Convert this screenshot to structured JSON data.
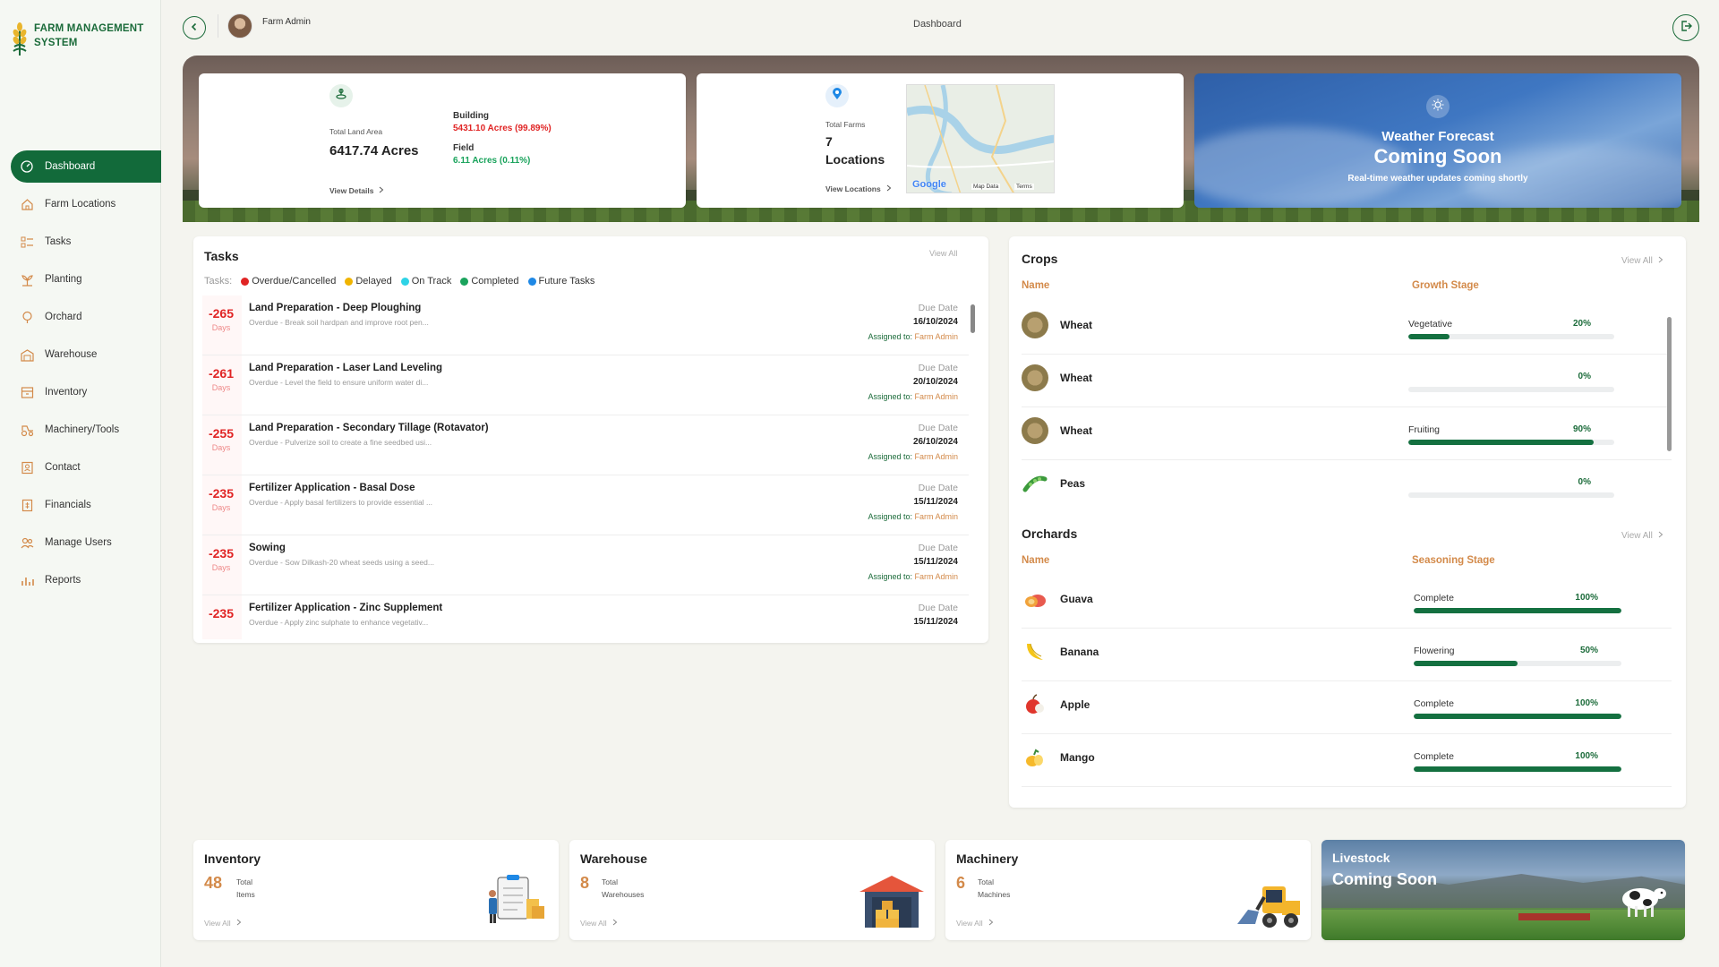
{
  "app": {
    "title": "FARM MANAGEMENT SYSTEM",
    "title_line1": "FARM MANAGEMENT",
    "title_line2": "SYSTEM"
  },
  "sidebar": {
    "items": [
      {
        "label": "Dashboard",
        "icon": "dashboard-icon",
        "active": true
      },
      {
        "label": "Farm Locations",
        "icon": "farm-locations-icon"
      },
      {
        "label": "Tasks",
        "icon": "tasks-icon"
      },
      {
        "label": "Planting",
        "icon": "planting-icon"
      },
      {
        "label": "Orchard",
        "icon": "orchard-icon"
      },
      {
        "label": "Warehouse",
        "icon": "warehouse-icon"
      },
      {
        "label": "Inventory",
        "icon": "inventory-icon"
      },
      {
        "label": "Machinery/Tools",
        "icon": "machinery-icon"
      },
      {
        "label": "Contact",
        "icon": "contact-icon"
      },
      {
        "label": "Financials",
        "icon": "financials-icon"
      },
      {
        "label": "Manage Users",
        "icon": "users-icon"
      },
      {
        "label": "Reports",
        "icon": "reports-icon"
      }
    ]
  },
  "header": {
    "user": "Farm Admin",
    "page_title": "Dashboard"
  },
  "land": {
    "label": "Total Land Area",
    "value": "6417.74 Acres",
    "building_label": "Building",
    "building_value": "5431.10 Acres (99.89%)",
    "field_label": "Field",
    "field_value": "6.11 Acres (0.11%)",
    "view": "View Details"
  },
  "farms": {
    "label": "Total Farms",
    "count": "7",
    "unit": "Locations",
    "view": "View Locations",
    "map_labels": {
      "google": "Google",
      "map_data": "Map Data",
      "terms": "Terms"
    }
  },
  "weather": {
    "title": "Weather Forecast",
    "status": "Coming Soon",
    "subtitle": "Real-time weather updates coming shortly"
  },
  "tasks": {
    "title": "Tasks",
    "view_all": "View All",
    "legend_label": "Tasks:",
    "legend": [
      {
        "label": "Overdue/Cancelled",
        "color": "#e02424"
      },
      {
        "label": "Delayed",
        "color": "#f0b400"
      },
      {
        "label": "On Track",
        "color": "#2ed3e6"
      },
      {
        "label": "Completed",
        "color": "#1aa35c"
      },
      {
        "label": "Future Tasks",
        "color": "#1e88e5"
      }
    ],
    "due_label": "Due Date",
    "assigned_label": "Assigned to:",
    "days_label": "Days",
    "rows": [
      {
        "days": "-265",
        "title": "Land Preparation - Deep Ploughing",
        "desc": "Overdue - Break soil hardpan and improve root pen...",
        "date": "16/10/2024",
        "assignee": "Farm Admin"
      },
      {
        "days": "-261",
        "title": "Land Preparation - Laser Land Leveling",
        "desc": "Overdue - Level the field to ensure uniform water di...",
        "date": "20/10/2024",
        "assignee": "Farm Admin"
      },
      {
        "days": "-255",
        "title": "Land Preparation - Secondary Tillage (Rotavator)",
        "desc": "Overdue - Pulverize soil to create a fine seedbed usi...",
        "date": "26/10/2024",
        "assignee": "Farm Admin"
      },
      {
        "days": "-235",
        "title": "Fertilizer Application - Basal Dose",
        "desc": "Overdue - Apply basal fertilizers to provide essential ...",
        "date": "15/11/2024",
        "assignee": "Farm Admin"
      },
      {
        "days": "-235",
        "title": "Sowing",
        "desc": "Overdue - Sow Dilkash-20 wheat seeds using a seed...",
        "date": "15/11/2024",
        "assignee": "Farm Admin"
      },
      {
        "days": "-235",
        "title": "Fertilizer Application - Zinc Supplement",
        "desc": "Overdue - Apply zinc sulphate to enhance vegetativ...",
        "date": "15/11/2024",
        "assignee": ""
      }
    ]
  },
  "crops": {
    "title": "Crops",
    "view_all": "View All",
    "col_name": "Name",
    "col_stage": "Growth Stage",
    "rows": [
      {
        "name": "Wheat",
        "stage": "Vegetative",
        "pct": "20%",
        "progress": 0.2,
        "icon": "wheat-icon"
      },
      {
        "name": "Wheat",
        "stage": "",
        "pct": "0%",
        "progress": 0,
        "icon": "wheat-icon"
      },
      {
        "name": "Wheat",
        "stage": "Fruiting",
        "pct": "90%",
        "progress": 0.9,
        "icon": "wheat-icon"
      },
      {
        "name": "Peas",
        "stage": "",
        "pct": "0%",
        "progress": 0,
        "icon": "peas-icon"
      }
    ]
  },
  "orchards": {
    "title": "Orchards",
    "view_all": "View All",
    "col_name": "Name",
    "col_stage": "Seasoning Stage",
    "rows": [
      {
        "name": "Guava",
        "stage": "Complete",
        "pct": "100%",
        "progress": 1,
        "icon": "guava-icon"
      },
      {
        "name": "Banana",
        "stage": "Flowering",
        "pct": "50%",
        "progress": 0.5,
        "icon": "banana-icon"
      },
      {
        "name": "Apple",
        "stage": "Complete",
        "pct": "100%",
        "progress": 1,
        "icon": "apple-icon"
      },
      {
        "name": "Mango",
        "stage": "Complete",
        "pct": "100%",
        "progress": 1,
        "icon": "mango-icon"
      }
    ]
  },
  "bottom": {
    "inventory": {
      "title": "Inventory",
      "count": "48",
      "sub1": "Total",
      "sub2": "Items",
      "view": "View All"
    },
    "warehouse": {
      "title": "Warehouse",
      "count": "8",
      "sub1": "Total",
      "sub2": "Warehouses",
      "view": "View All"
    },
    "machinery": {
      "title": "Machinery",
      "count": "6",
      "sub1": "Total",
      "sub2": "Machines",
      "view": "View All"
    },
    "livestock": {
      "title": "Livestock",
      "status": "Coming Soon"
    }
  },
  "colors": {
    "brand_green": "#126a3a",
    "accent_orange": "#d38a4a",
    "overdue_red": "#e02424"
  }
}
